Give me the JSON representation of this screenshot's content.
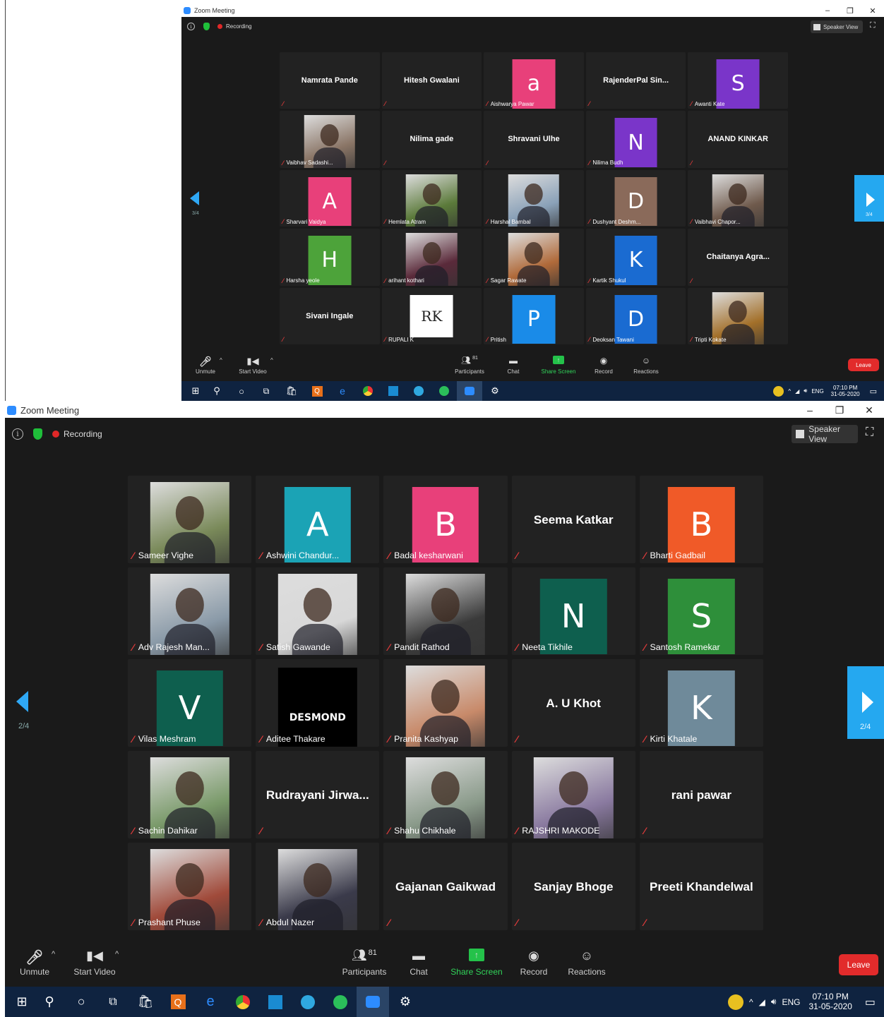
{
  "window1": {
    "title": "Zoom Meeting",
    "recording_label": "Recording",
    "speaker_view_label": "Speaker View",
    "page_indicator": "3/4",
    "tiles": [
      {
        "name": "Namrata Pande",
        "mode": "name"
      },
      {
        "name": "Hitesh Gwalani",
        "mode": "name"
      },
      {
        "name": "Aishwarya Pawar",
        "mode": "letter",
        "letter": "a",
        "color": "#e8407a"
      },
      {
        "name": "RajenderPal  Sin...",
        "mode": "name"
      },
      {
        "name": "Awanti Kate",
        "mode": "letter",
        "letter": "S",
        "color": "#7a35c9"
      },
      {
        "name": "Vaibhav Sadashi...",
        "mode": "photo",
        "color": "#8a7566"
      },
      {
        "name": "Nilima gade",
        "mode": "name"
      },
      {
        "name": "Shravani Ulhe",
        "mode": "name"
      },
      {
        "name": "Nilima Budh",
        "mode": "letter",
        "letter": "N",
        "color": "#7a35c9"
      },
      {
        "name": "ANAND KINKAR",
        "mode": "name"
      },
      {
        "name": "Sharvari Vaidya",
        "mode": "letter",
        "letter": "A",
        "color": "#e8407a"
      },
      {
        "name": "Hemlata Atram",
        "mode": "photo",
        "color": "#5b7a3a"
      },
      {
        "name": "Harshal Bambal",
        "mode": "photo",
        "color": "#8aa1b8"
      },
      {
        "name": "Dushyant Deshm...",
        "mode": "letter",
        "letter": "D",
        "color": "#8a6a5a"
      },
      {
        "name": "Vaibhavi Chapor...",
        "mode": "photo",
        "color": "#6f5a4c"
      },
      {
        "name": "Harsha yeole",
        "mode": "letter",
        "letter": "H",
        "color": "#4da33a"
      },
      {
        "name": "arihant kothari",
        "mode": "photo",
        "color": "#5a2a3a"
      },
      {
        "name": "Sagar Rawate",
        "mode": "photo",
        "color": "#b06a3a"
      },
      {
        "name": "Kartik Shukul",
        "mode": "letter",
        "letter": "K",
        "color": "#1a6bd1"
      },
      {
        "name": "Chaitanya  Agra...",
        "mode": "name"
      },
      {
        "name": "Sivani Ingale",
        "mode": "name"
      },
      {
        "name": "RUPALI K",
        "mode": "rk",
        "letter": "RK",
        "color": "#ffffff"
      },
      {
        "name": "Pritish",
        "mode": "letter",
        "letter": "P",
        "color": "#1a8be8"
      },
      {
        "name": "Deoksan Tawani",
        "mode": "letter",
        "letter": "D",
        "color": "#1a6bd1"
      },
      {
        "name": "Tripti Kokate",
        "mode": "photo",
        "color": "#a3702a"
      }
    ]
  },
  "window2": {
    "title": "Zoom Meeting",
    "recording_label": "Recording",
    "speaker_view_label": "Speaker View",
    "page_indicator": "2/4",
    "tiles": [
      {
        "name": "Sameer Vighe",
        "mode": "photo",
        "color": "#7a8a5a"
      },
      {
        "name": "Ashwini Chandur...",
        "mode": "letter",
        "letter": "A",
        "color": "#1ba3b5"
      },
      {
        "name": "Badal kesharwani",
        "mode": "letter",
        "letter": "B",
        "color": "#e8407a"
      },
      {
        "name": "Seema Katkar",
        "mode": "name"
      },
      {
        "name": "Bharti Gadbail",
        "mode": "letter",
        "letter": "B",
        "color": "#f05a28"
      },
      {
        "name": "Adv Rajesh Man...",
        "mode": "photo",
        "color": "#8a9aa8"
      },
      {
        "name": "Satish Gawande",
        "mode": "photo",
        "color": "#d8d8d8"
      },
      {
        "name": "Pandit Rathod",
        "mode": "photo",
        "color": "#3a3a3a"
      },
      {
        "name": "Neeta Tikhile",
        "mode": "letter",
        "letter": "N",
        "color": "#0e5f4e"
      },
      {
        "name": "Santosh Ramekar",
        "mode": "letter",
        "letter": "S",
        "color": "#2e8f3a"
      },
      {
        "name": "Vilas Meshram",
        "mode": "letter",
        "letter": "V",
        "color": "#0e5f4e"
      },
      {
        "name": "Aditee Thakare",
        "mode": "desmond",
        "letter": "DESMOND",
        "color": "#000000"
      },
      {
        "name": "Pranita Kashyap",
        "mode": "photo",
        "color": "#c88a6a"
      },
      {
        "name": "A. U Khot",
        "mode": "name"
      },
      {
        "name": "Kirti Khatale",
        "mode": "letter",
        "letter": "K",
        "color": "#6f8a9a"
      },
      {
        "name": "Sachin Dahikar",
        "mode": "photo",
        "color": "#7a9a6a"
      },
      {
        "name": "Rudrayani  Jirwa...",
        "mode": "name"
      },
      {
        "name": "Shahu Chikhale",
        "mode": "photo",
        "color": "#8a9a8a"
      },
      {
        "name": "RAJSHRI MAKODE",
        "mode": "photo",
        "color": "#8a7aa0"
      },
      {
        "name": "rani pawar",
        "mode": "name"
      },
      {
        "name": "Prashant Phuse",
        "mode": "photo",
        "color": "#a04a3a"
      },
      {
        "name": "Abdul Nazer",
        "mode": "photo",
        "color": "#3a3a4a"
      },
      {
        "name": "Gajanan Gaikwad",
        "mode": "name"
      },
      {
        "name": "Sanjay Bhoge",
        "mode": "name"
      },
      {
        "name": "Preeti Khandelwal",
        "mode": "name"
      }
    ]
  },
  "toolbar": {
    "unmute": "Unmute",
    "start_video": "Start Video",
    "participants_count": "81",
    "participants": "Participants",
    "chat": "Chat",
    "share_screen": "Share Screen",
    "record": "Record",
    "reactions": "Reactions",
    "leave": "Leave"
  },
  "taskbar": {
    "language": "ENG",
    "time": "07:10 PM",
    "date": "31-05-2020"
  },
  "colors": {
    "accent": "#2d8cff",
    "leave": "#e22b2b",
    "share": "#24c24a",
    "nav": "#25a8f0"
  }
}
